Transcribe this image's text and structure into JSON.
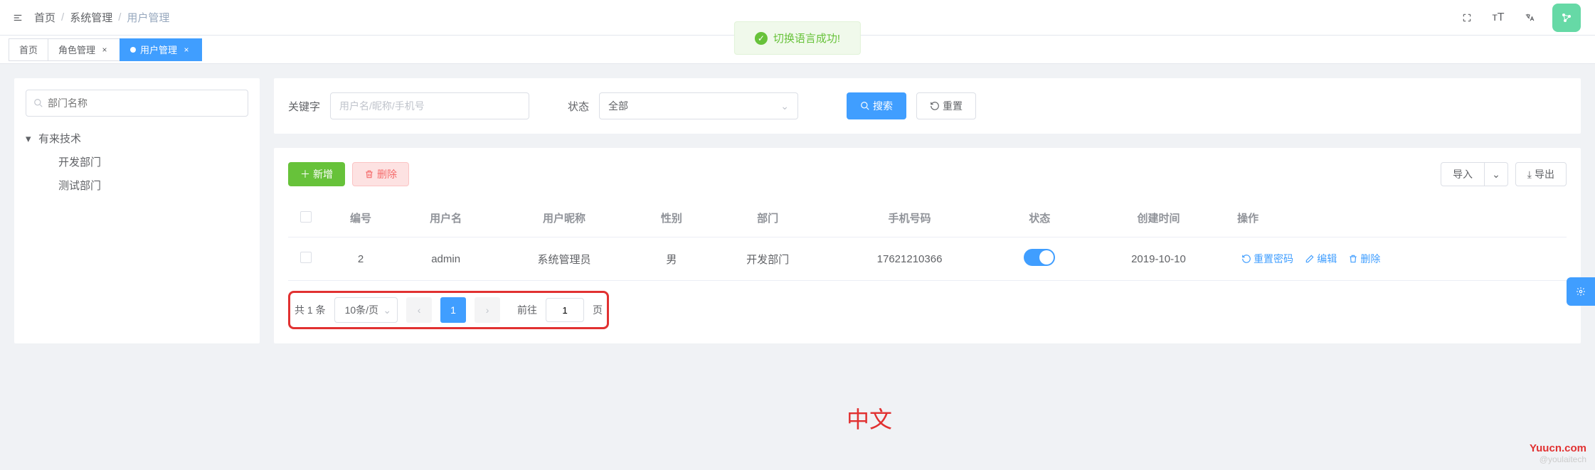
{
  "breadcrumb": {
    "home": "首页",
    "sys": "系统管理",
    "user": "用户管理"
  },
  "tabs": {
    "home": "首页",
    "role": "角色管理",
    "user": "用户管理"
  },
  "toast": "切换语言成功!",
  "dept": {
    "placeholder": "部门名称",
    "root": "有来技术",
    "c1": "开发部门",
    "c2": "测试部门"
  },
  "filter": {
    "kw_label": "关键字",
    "kw_ph": "用户名/昵称/手机号",
    "status_label": "状态",
    "status_val": "全部",
    "search": "搜索",
    "reset": "重置"
  },
  "toolbar": {
    "add": "新增",
    "del": "删除",
    "import": "导入",
    "export": "导出"
  },
  "table": {
    "h_id": "编号",
    "h_user": "用户名",
    "h_nick": "用户昵称",
    "h_sex": "性别",
    "h_dept": "部门",
    "h_phone": "手机号码",
    "h_status": "状态",
    "h_time": "创建时间",
    "h_ops": "操作",
    "r0": {
      "id": "2",
      "user": "admin",
      "nick": "系统管理员",
      "sex": "男",
      "dept": "开发部门",
      "phone": "17621210366",
      "time": "2019-10-10"
    },
    "op_reset": "重置密码",
    "op_edit": "编辑",
    "op_del": "删除"
  },
  "page": {
    "total": "共 1 条",
    "size": "10条/页",
    "cur": "1",
    "goto": "前往",
    "goto_val": "1",
    "page_unit": "页"
  },
  "annotation": "中文",
  "watermark": {
    "brand": "Yuucn.com",
    "sub": "@youlaitech"
  }
}
